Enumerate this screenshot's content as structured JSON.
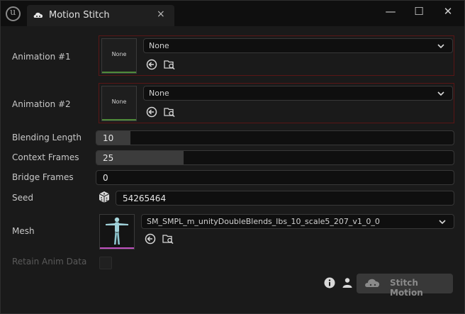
{
  "window": {
    "tab_title": "Motion Stitch",
    "tab_close": "×",
    "minimize": "—",
    "maximize": "☐",
    "close": "✕"
  },
  "animation1": {
    "label": "Animation #1",
    "thumb_text": "None",
    "selected": "None"
  },
  "animation2": {
    "label": "Animation #2",
    "thumb_text": "None",
    "selected": "None"
  },
  "blending_length": {
    "label": "Blending Length",
    "value": "10",
    "fill_fraction": 0.095
  },
  "context_frames": {
    "label": "Context Frames",
    "value": "25",
    "fill_fraction": 0.245
  },
  "bridge_frames": {
    "label": "Bridge Frames",
    "value": "0",
    "fill_fraction": 0
  },
  "seed": {
    "label": "Seed",
    "value": "54265464"
  },
  "mesh": {
    "label": "Mesh",
    "selected": "SM_SMPL_m_unityDoubleBlends_lbs_10_scale5_207_v1_0_0"
  },
  "retain_anim_data": {
    "label": "Retain Anim Data",
    "checked": false
  },
  "action": {
    "stitch_label": "Stitch Motion"
  },
  "colors": {
    "background": "#1a1a1a",
    "titlebar": "#0f0f0f",
    "asset_border": "#5a1616",
    "anim_thumb_bar": "#4e8a3a",
    "mesh_thumb_bar": "#c050c0",
    "button_disabled": "#383838"
  }
}
